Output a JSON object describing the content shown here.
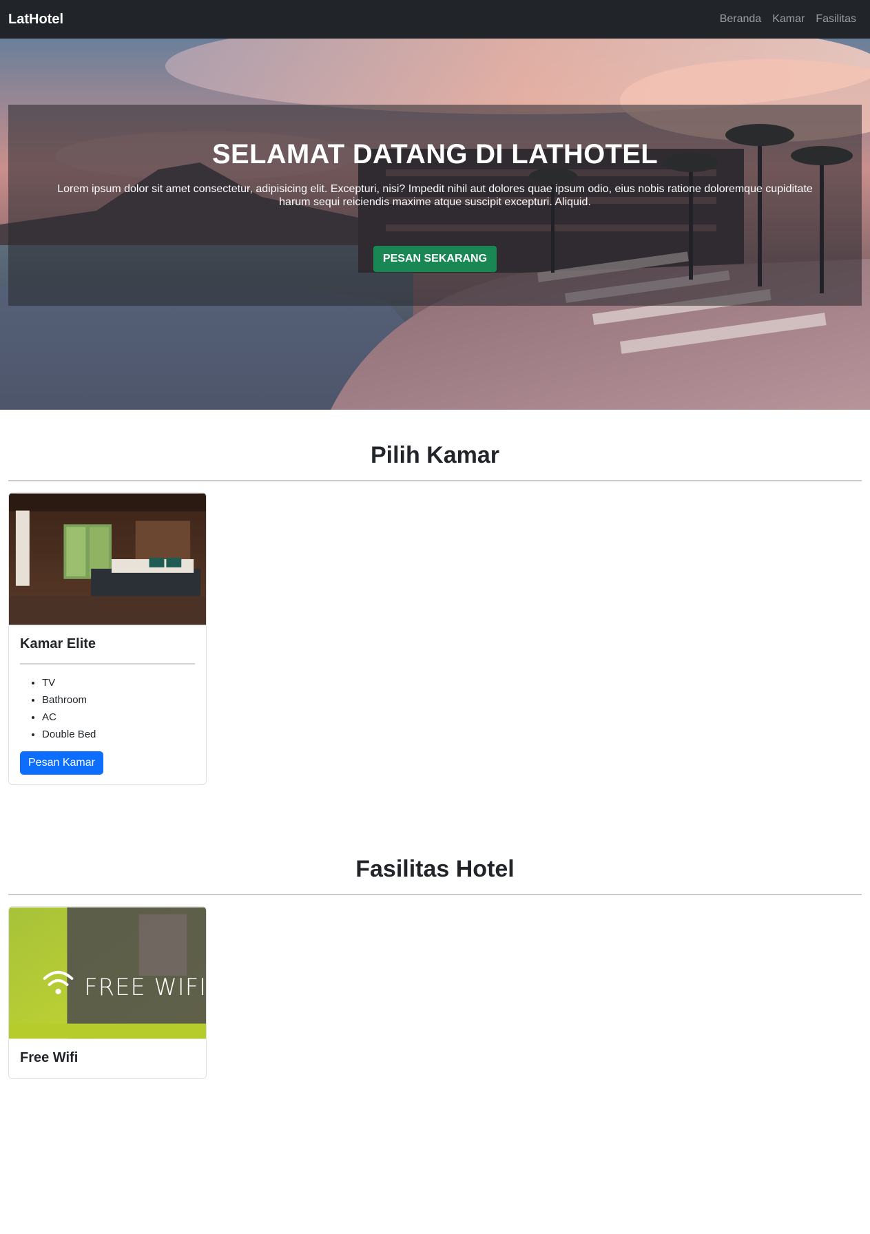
{
  "navbar": {
    "brand": "LatHotel",
    "links": [
      "Beranda",
      "Kamar",
      "Fasilitas"
    ]
  },
  "hero": {
    "title": "SELAMAT DATANG DI LATHOTEL",
    "text": "Lorem ipsum dolor sit amet consectetur, adipisicing elit. Excepturi, nisi? Impedit nihil aut dolores quae ipsum odio, eius nobis ratione doloremque cupiditate harum sequi reiciendis maxime atque suscipit excepturi. Aliquid.",
    "button_label": "PESAN SEKARANG"
  },
  "rooms": {
    "title": "Pilih Kamar",
    "cards": [
      {
        "name": "Kamar Elite",
        "features": [
          "TV",
          "Bathroom",
          "AC",
          "Double Bed"
        ],
        "button_label": "Pesan Kamar"
      }
    ]
  },
  "facilities": {
    "title": "Fasilitas Hotel",
    "cards": [
      {
        "name": "Free Wifi",
        "sign_text": "FREE WIFI"
      }
    ]
  },
  "colors": {
    "navbar_bg": "#212529",
    "success": "#198754",
    "primary": "#0d6efd"
  }
}
